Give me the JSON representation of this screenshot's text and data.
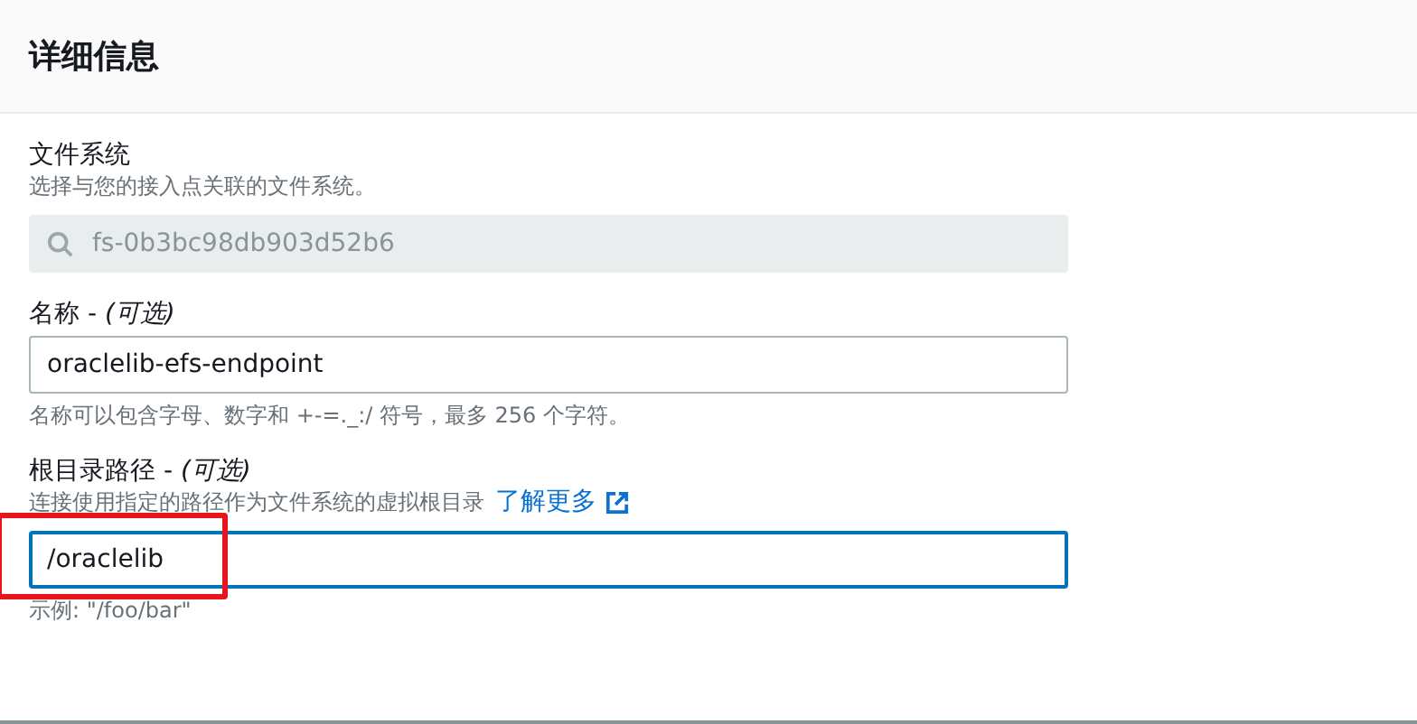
{
  "header": {
    "title": "详细信息"
  },
  "fields": [
    {
      "kind": "search",
      "label": "文件系统",
      "description": "选择与您的接入点关联的文件系统。",
      "value": "fs-0b3bc98db903d52b6",
      "disabled": true
    },
    {
      "kind": "text",
      "label": "名称 - *(可选)*",
      "value": "oraclelib-efs-endpoint",
      "hint": "名称可以包含字母、数字和 +-=._:/ 符号，最多 256 个字符。"
    },
    {
      "kind": "text",
      "label": "根目录路径 - *(可选)*",
      "description": "连接使用指定的路径作为文件系统的虚拟根目录",
      "link": "了解更多",
      "value": "/oraclelib",
      "hint": "示例: \"/foo/bar\"",
      "focused": true,
      "highlighted": true
    }
  ]
}
